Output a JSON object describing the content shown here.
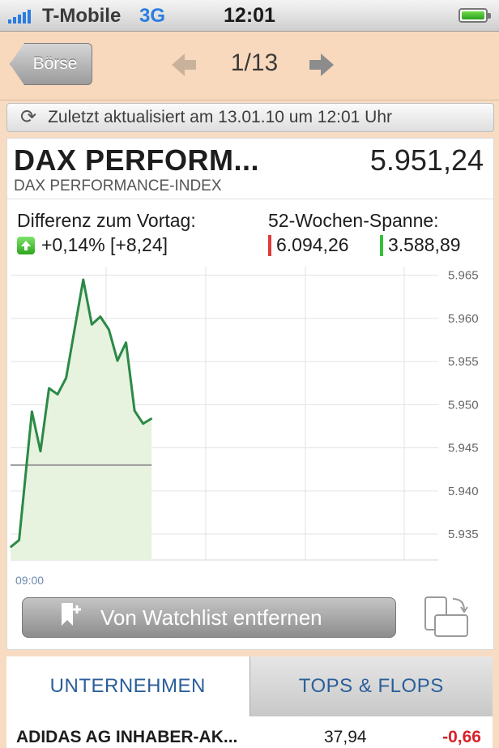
{
  "status_bar": {
    "carrier": "T-Mobile",
    "network": "3G",
    "time": "12:01"
  },
  "nav": {
    "back_label": "Börse",
    "pager": "1/13"
  },
  "update_text": "Zuletzt aktualisiert am 13.01.10 um 12:01 Uhr",
  "quote": {
    "title": "DAX PERFORM...",
    "price": "5.951,24",
    "full_name": "DAX PERFORMANCE-INDEX",
    "diff_label": "Differenz zum Vortag:",
    "diff_value": "+0,14% [+8,24]",
    "range_label": "52-Wochen-Spanne:",
    "range_high": "6.094,26",
    "range_low": "3.588,89"
  },
  "chart_data": {
    "type": "area",
    "x_tick_labels": [
      "09:00"
    ],
    "y_ticks": [
      "5.965",
      "5.960",
      "5.955",
      "5.950",
      "5.945",
      "5.940",
      "5.935"
    ],
    "ylim": [
      5932,
      5966
    ],
    "reference_line": 5943,
    "x_range": [
      0,
      100
    ],
    "points": [
      [
        0,
        5933.5
      ],
      [
        2,
        5934.3
      ],
      [
        5,
        5949.2
      ],
      [
        7,
        5944.6
      ],
      [
        9,
        5951.9
      ],
      [
        11,
        5951.2
      ],
      [
        13,
        5953.1
      ],
      [
        15,
        5958.8
      ],
      [
        17,
        5964.5
      ],
      [
        19,
        5959.3
      ],
      [
        21,
        5960.2
      ],
      [
        23,
        5958.7
      ],
      [
        25,
        5955.1
      ],
      [
        27,
        5957.2
      ],
      [
        29,
        5949.3
      ],
      [
        31,
        5947.8
      ],
      [
        33,
        5948.4
      ]
    ],
    "line_color": "#2a8a46",
    "fill_color": "#e7f2df",
    "grid": true
  },
  "watch_button_label": "Von Watchlist entfernen",
  "tabs": [
    "UNTERNEHMEN",
    "TOPS & FLOPS"
  ],
  "list": [
    {
      "name": "ADIDAS AG INHABER-AK...",
      "price": "37,94",
      "change": "-0,66"
    }
  ]
}
